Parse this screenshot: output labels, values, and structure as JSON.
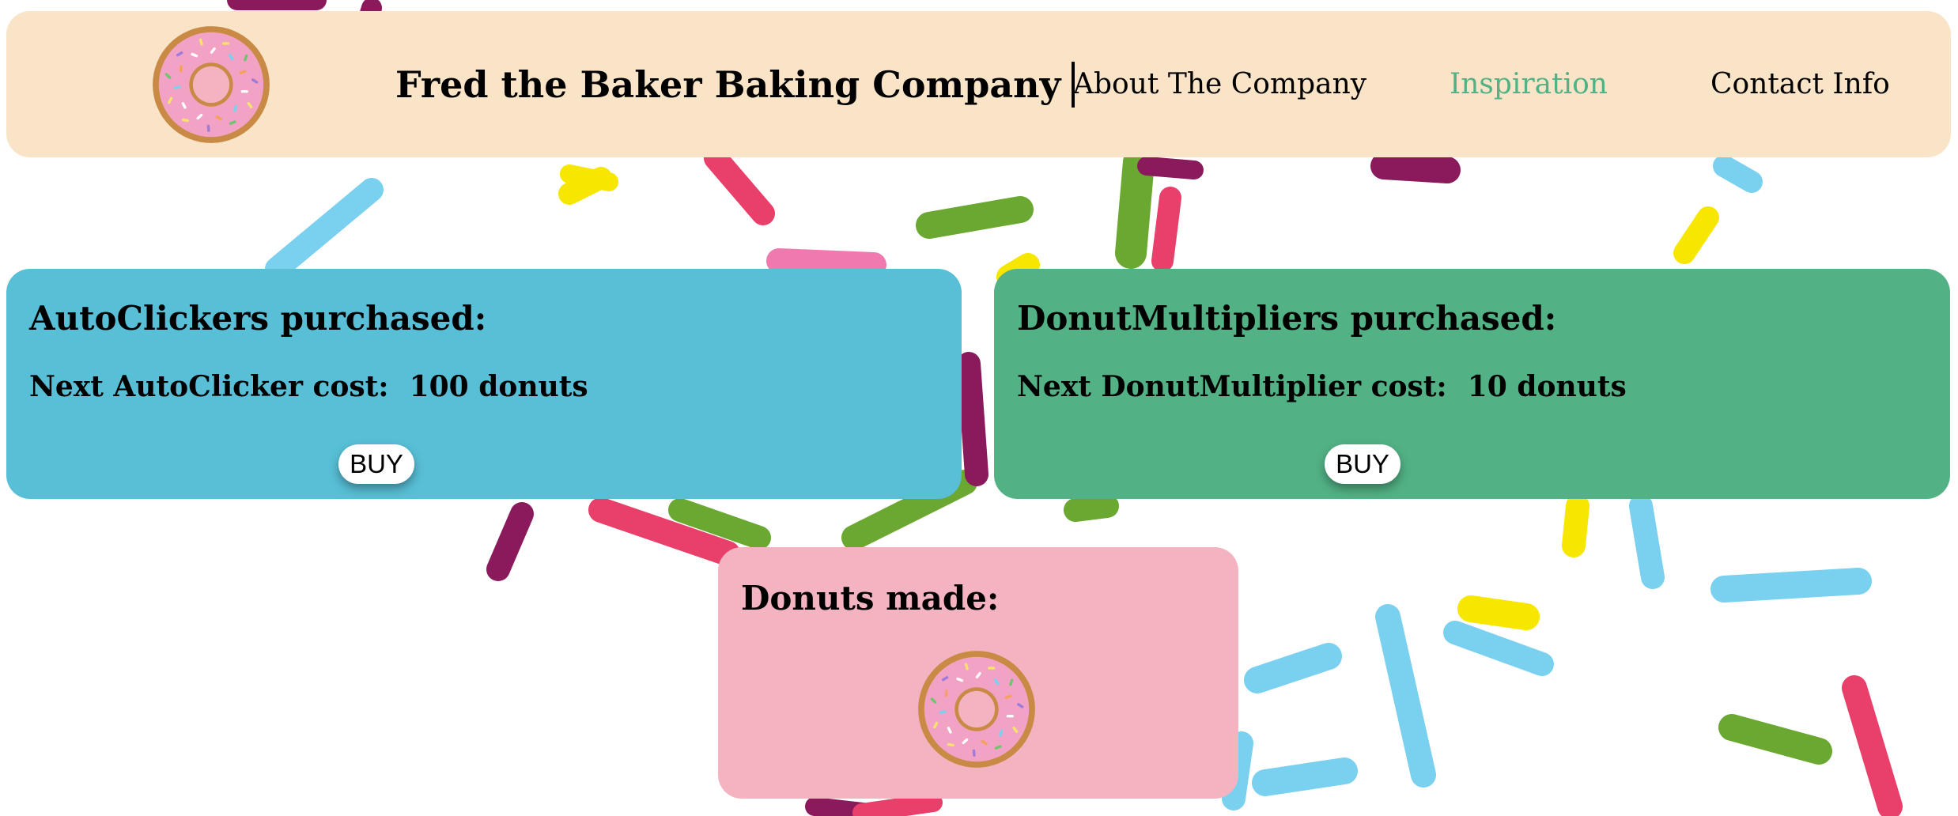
{
  "colors": {
    "header_bg": "#fae4c7",
    "autoclicker_panel": "#58bfd6",
    "multiplier_panel": "#52b185",
    "donuts_panel": "#f4b3c1",
    "nav_active": "#52b185"
  },
  "header": {
    "logo_icon": "donut-icon",
    "brand": "Fred the Baker Baking Company",
    "nav": [
      {
        "label": "About The Company",
        "active": false
      },
      {
        "label": "Inspiration",
        "active": true
      },
      {
        "label": "Contact Info",
        "active": false
      }
    ]
  },
  "autoclicker": {
    "title": "AutoClickers purchased:",
    "cost_label": "Next AutoClicker cost:",
    "cost_value": "100 donuts",
    "buy_label": "BUY"
  },
  "multiplier": {
    "title": "DonutMultipliers purchased:",
    "cost_label": "Next DonutMultiplier cost:",
    "cost_value": "10 donuts",
    "buy_label": "BUY"
  },
  "donuts": {
    "title": "Donuts made:",
    "donut_icon": "donut-icon"
  },
  "background": {
    "icon": "sprinkles-background"
  }
}
